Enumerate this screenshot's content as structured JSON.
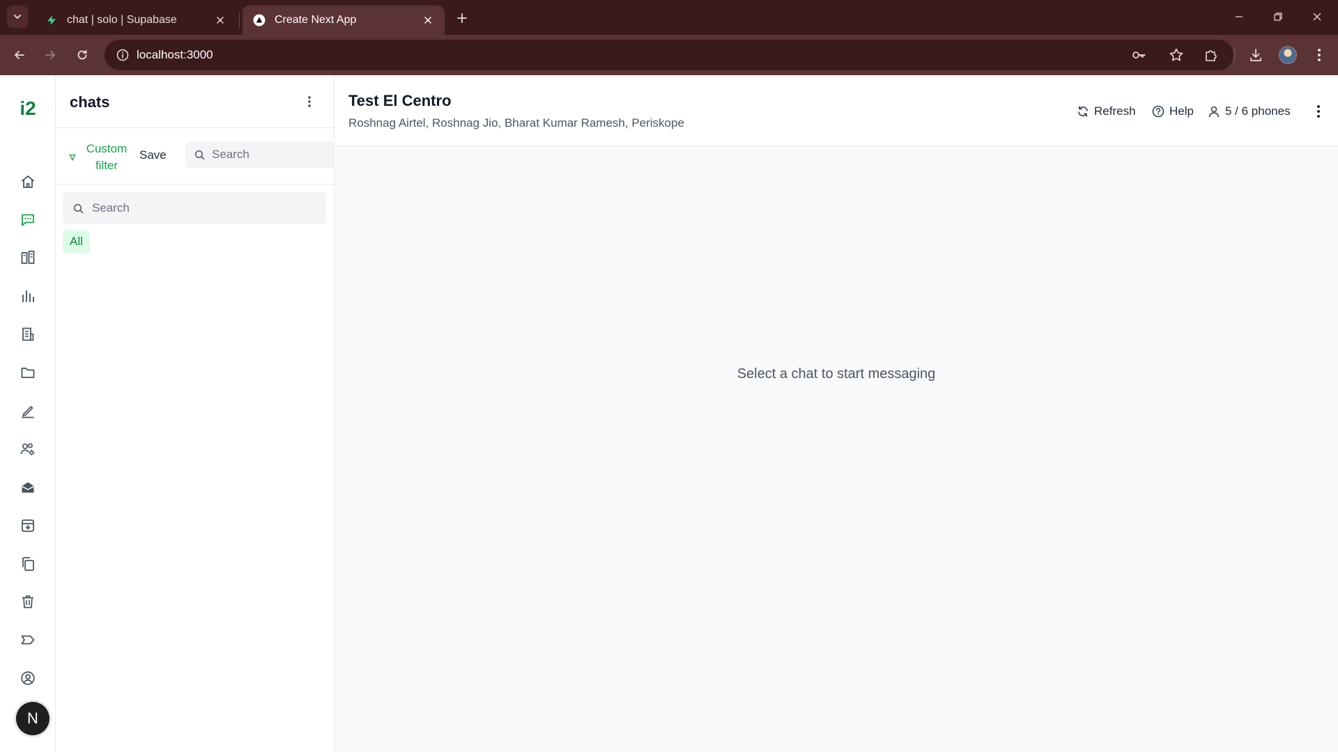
{
  "browser": {
    "tabs": [
      {
        "title": "chat | solo | Supabase",
        "favicon": "supabase-bolt-icon",
        "active": false
      },
      {
        "title": "Create Next App",
        "favicon": "nextjs-triangle-icon",
        "active": true
      }
    ],
    "url": "localhost:3000"
  },
  "sidebar": {
    "logo": "i2",
    "items": [
      {
        "icon": "home-icon"
      },
      {
        "icon": "chat-icon",
        "active": true
      },
      {
        "icon": "columns-icon"
      },
      {
        "icon": "bar-chart-icon"
      },
      {
        "icon": "list-doc-icon"
      },
      {
        "icon": "folder-icon"
      },
      {
        "icon": "pen-icon"
      },
      {
        "icon": "users-settings-icon"
      },
      {
        "icon": "mail-icon"
      },
      {
        "icon": "archive-icon"
      },
      {
        "icon": "copy-icon"
      },
      {
        "icon": "trash-icon"
      },
      {
        "icon": "label-icon"
      },
      {
        "icon": "user-circle-icon"
      }
    ],
    "user_avatar": "N"
  },
  "chat_panel": {
    "title": "chats",
    "custom_filter_label": "Custom filter",
    "save_label": "Save",
    "filter_search_placeholder": "Search",
    "list_search_placeholder": "Search",
    "chips": [
      "All"
    ]
  },
  "main": {
    "title": "Test El Centro",
    "members": "Roshnag Airtel, Roshnag Jio, Bharat Kumar Ramesh, Periskope",
    "refresh_label": "Refresh",
    "help_label": "Help",
    "phones_label": "5 / 6 phones",
    "empty_state": "Select a chat to start messaging"
  },
  "colors": {
    "accent": "#16a34a",
    "chrome_dark": "#3b1a1c",
    "chrome_mid": "#5b3335",
    "chip_bg": "#dcfce7"
  }
}
